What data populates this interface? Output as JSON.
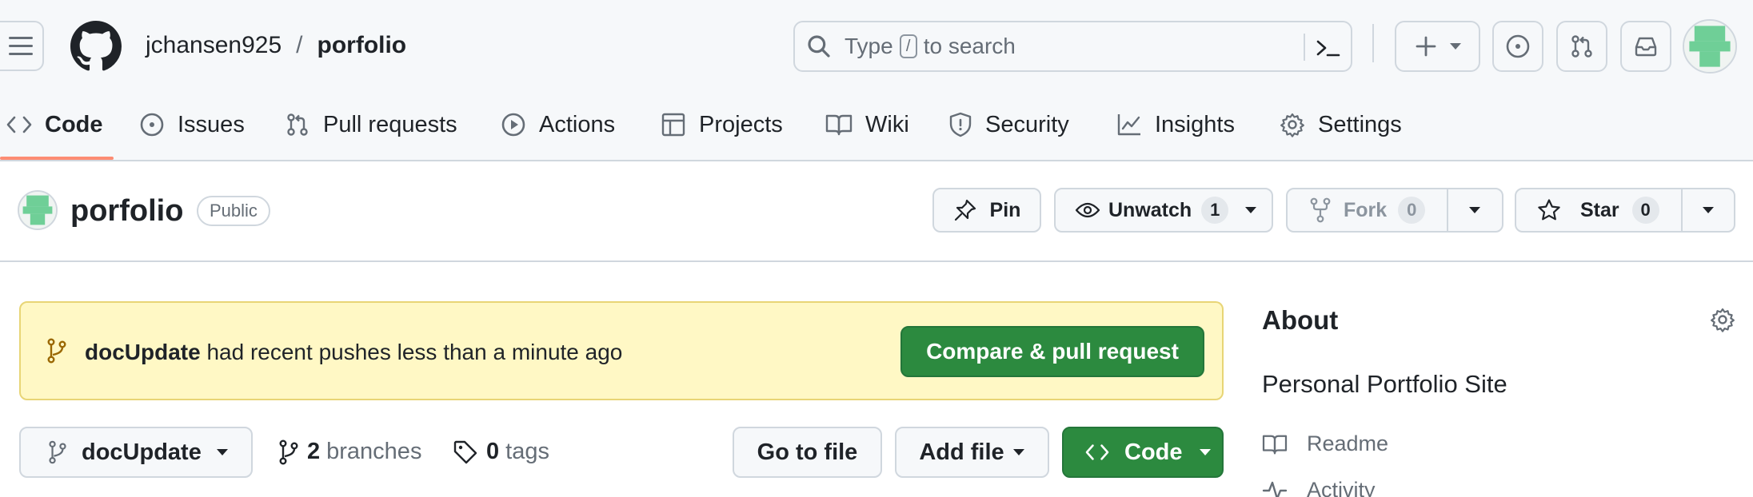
{
  "header": {
    "owner": "jchansen925",
    "separator": "/",
    "repo": "porfolio",
    "search": {
      "prefix": "Type",
      "key": "/",
      "suffix": "to search"
    }
  },
  "tabs": [
    {
      "label": "Code",
      "icon": "code-icon",
      "active": true
    },
    {
      "label": "Issues",
      "icon": "issue-icon"
    },
    {
      "label": "Pull requests",
      "icon": "pull-request-icon"
    },
    {
      "label": "Actions",
      "icon": "play-icon"
    },
    {
      "label": "Projects",
      "icon": "table-icon"
    },
    {
      "label": "Wiki",
      "icon": "book-icon"
    },
    {
      "label": "Security",
      "icon": "shield-icon"
    },
    {
      "label": "Insights",
      "icon": "graph-icon"
    },
    {
      "label": "Settings",
      "icon": "gear-icon"
    }
  ],
  "repo": {
    "title": "porfolio",
    "visibility": "Public",
    "pin_label": "Pin",
    "watch_label": "Unwatch",
    "watch_count": "1",
    "fork_label": "Fork",
    "fork_count": "0",
    "star_label": "Star",
    "star_count": "0"
  },
  "banner": {
    "branch": "docUpdate",
    "message": "had recent pushes less than a minute ago",
    "button": "Compare & pull request"
  },
  "branch_bar": {
    "current_branch": "docUpdate",
    "branches_count": "2",
    "branches_label": "branches",
    "tags_count": "0",
    "tags_label": "tags",
    "go_to_file": "Go to file",
    "add_file": "Add file",
    "code": "Code"
  },
  "about": {
    "title": "About",
    "description": "Personal Portfolio Site",
    "readme": "Readme",
    "activity": "Activity"
  },
  "colors": {
    "primary_green": "#2c8a3f",
    "active_tab_underline": "#fd8c73",
    "banner_bg": "#fff8c5",
    "avatar_green": "#6fcf97"
  }
}
